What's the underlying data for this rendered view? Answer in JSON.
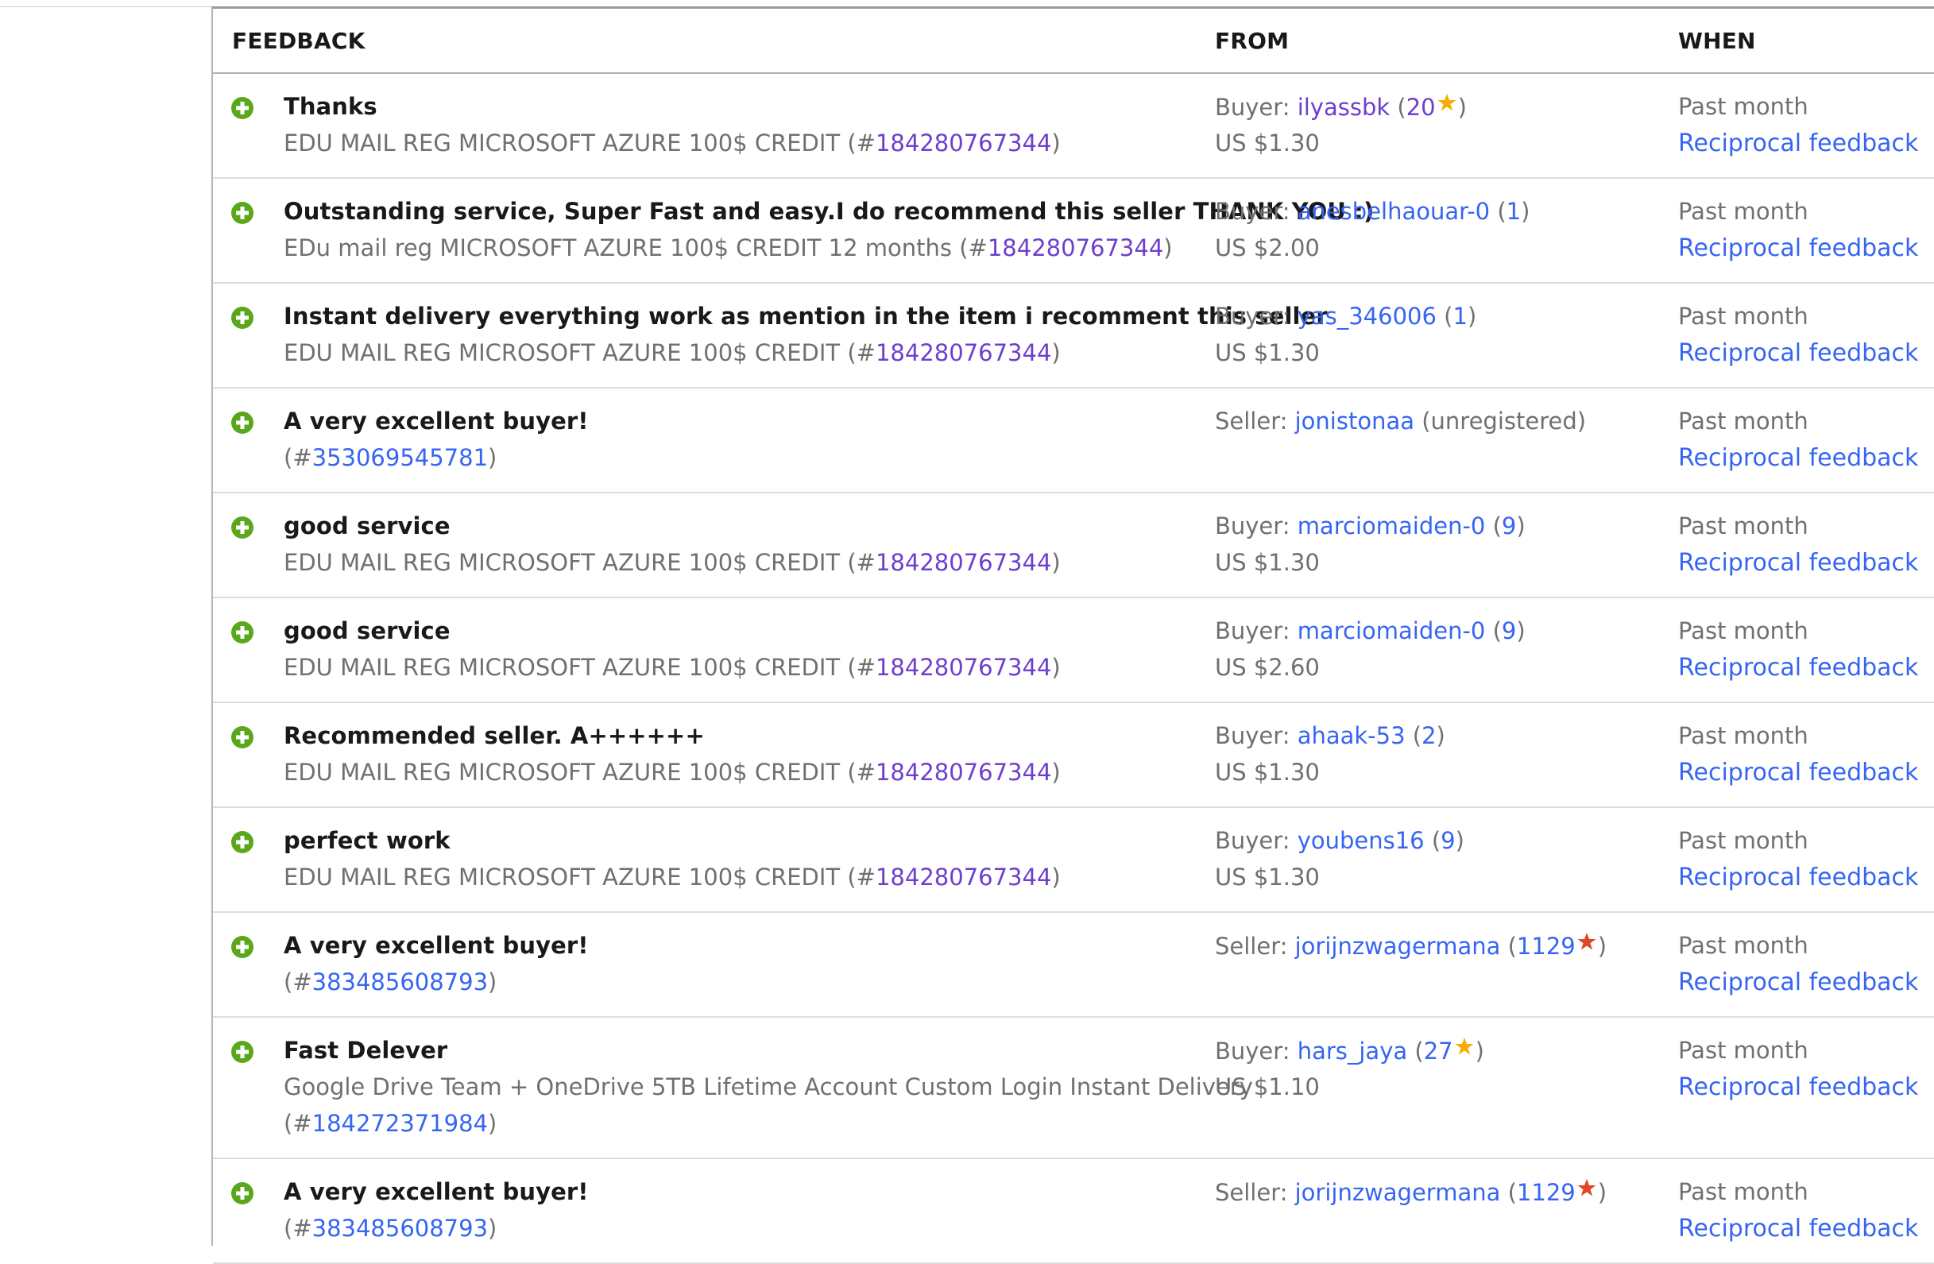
{
  "header": {
    "feedback": "FEEDBACK",
    "from": "FROM",
    "when": "WHEN"
  },
  "colors": {
    "link": "#3665f3",
    "visited": "#6e3fcf",
    "positive": "#5ba71b",
    "star_yellow": "#f5af02",
    "star_red": "#e0462a"
  },
  "rows": [
    {
      "title": "Thanks",
      "item_text": "EDU MAIL REG MICROSOFT AZURE 100$ CREDIT (#",
      "item_number": "184280767344",
      "item_close": ")",
      "role": "Buyer: ",
      "user": "ilyassbk",
      "score_open": " (",
      "score": "20",
      "score_close": ")",
      "star": "star-yellow-icon",
      "price": "US $1.30",
      "when": "Past month",
      "reciprocal": "Reciprocal feedback"
    },
    {
      "title": "Outstanding service, Super Fast and easy.I do recommend this seller THANK YOU :)",
      "item_text": "EDu mail reg MICROSOFT AZURE 100$ CREDIT 12 months (#",
      "item_number": "184280767344",
      "item_close": ")",
      "role": "Buyer: ",
      "user": "anesbelhaouar-0",
      "score_open": " (",
      "score": "1",
      "score_close": ")",
      "price": "US $2.00",
      "when": "Past month",
      "reciprocal": "Reciprocal feedback"
    },
    {
      "title": "Instant delivery everything work as mention in the item i recomment this seller",
      "item_text": "EDU MAIL REG MICROSOFT AZURE 100$ CREDIT (#",
      "item_number": "184280767344",
      "item_close": ")",
      "role": "Buyer: ",
      "user": "yas_346006",
      "score_open": " (",
      "score": "1",
      "score_close": ")",
      "price": "US $1.30",
      "when": "Past month",
      "reciprocal": "Reciprocal feedback"
    },
    {
      "title": "A very excellent buyer!",
      "item_text": "(#",
      "item_number": "353069545781",
      "item_close": ")",
      "role": "Seller: ",
      "user": "jonistonaa",
      "unregistered": " (unregistered)",
      "price": "",
      "when": "Past month",
      "reciprocal": "Reciprocal feedback"
    },
    {
      "title": "good service",
      "item_text": "EDU MAIL REG MICROSOFT AZURE 100$ CREDIT (#",
      "item_number": "184280767344",
      "item_close": ")",
      "role": "Buyer: ",
      "user": "marciomaiden-0",
      "score_open": " (",
      "score": "9",
      "score_close": ")",
      "price": "US $1.30",
      "when": "Past month",
      "reciprocal": "Reciprocal feedback"
    },
    {
      "title": "good service",
      "item_text": "EDU MAIL REG MICROSOFT AZURE 100$ CREDIT (#",
      "item_number": "184280767344",
      "item_close": ")",
      "role": "Buyer: ",
      "user": "marciomaiden-0",
      "score_open": " (",
      "score": "9",
      "score_close": ")",
      "price": "US $2.60",
      "when": "Past month",
      "reciprocal": "Reciprocal feedback"
    },
    {
      "title": "Recommended seller. A++++++",
      "item_text": "EDU MAIL REG MICROSOFT AZURE 100$ CREDIT (#",
      "item_number": "184280767344",
      "item_close": ")",
      "role": "Buyer: ",
      "user": "ahaak-53",
      "score_open": " (",
      "score": "2",
      "score_close": ")",
      "price": "US $1.30",
      "when": "Past month",
      "reciprocal": "Reciprocal feedback"
    },
    {
      "title": "perfect work",
      "item_text": "EDU MAIL REG MICROSOFT AZURE 100$ CREDIT (#",
      "item_number": "184280767344",
      "item_close": ")",
      "role": "Buyer: ",
      "user": "youbens16",
      "score_open": " (",
      "score": "9",
      "score_close": ")",
      "price": "US $1.30",
      "when": "Past month",
      "reciprocal": "Reciprocal feedback"
    },
    {
      "title": "A very excellent buyer!",
      "item_text": "(#",
      "item_number": "383485608793",
      "item_close": ")",
      "role": "Seller: ",
      "user": "jorijnzwagermana",
      "score_open": " (",
      "score": "1129",
      "score_close": ")",
      "star": "star-red-icon",
      "price": "",
      "when": "Past month",
      "reciprocal": "Reciprocal feedback"
    },
    {
      "title": "Fast Delever",
      "item_text": "Google Drive Team + OneDrive 5TB Lifetime Account Custom Login Instant Delivery",
      "item2_text": "(#",
      "item_number": "184272371984",
      "item_close": ")",
      "role": "Buyer: ",
      "user": "hars_jaya",
      "score_open": " (",
      "score": "27",
      "score_close": ")",
      "star": "star-yellow-icon",
      "price": "US $1.10",
      "when": "Past month",
      "reciprocal": "Reciprocal feedback"
    },
    {
      "title": "A very excellent buyer!",
      "item_text": "(#",
      "item_number": "383485608793",
      "item_close": ")",
      "role": "Seller: ",
      "user": "jorijnzwagermana",
      "score_open": " (",
      "score": "1129",
      "score_close": ")",
      "star": "star-red-icon",
      "price": "",
      "when": "Past month",
      "reciprocal": "Reciprocal feedback"
    }
  ]
}
